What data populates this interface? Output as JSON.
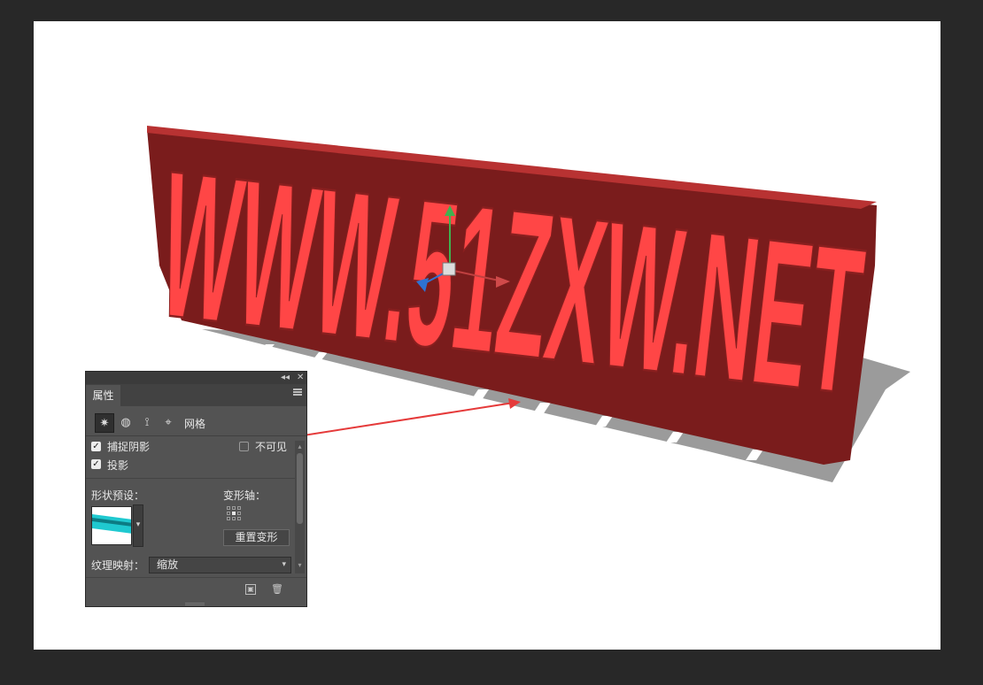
{
  "canvas": {
    "art_text": "WWW.51ZXW.NET",
    "face_color": "#ff4444",
    "side_color": "#7a1c1c",
    "shadow_color": "#9b9b9b"
  },
  "panel": {
    "collapse_glyph": "◂◂",
    "close_glyph": "✕",
    "tab_label": "属性",
    "icon_buttons": [
      "mesh-icon",
      "deform-icon",
      "cap-icon",
      "coordinates-icon"
    ],
    "mesh_label": "网格",
    "catch_shadows": {
      "label": "捕捉阴影",
      "checked": true
    },
    "cast_shadows": {
      "label": "投影",
      "checked": true
    },
    "invisible": {
      "label": "不可见",
      "checked": false
    },
    "shape_preset_label": "形状预设：",
    "deform_axis_label": "变形轴：",
    "reset_deform_label": "重置变形",
    "texture_map_label": "纹理映射：",
    "texture_map_value": "缩放"
  }
}
